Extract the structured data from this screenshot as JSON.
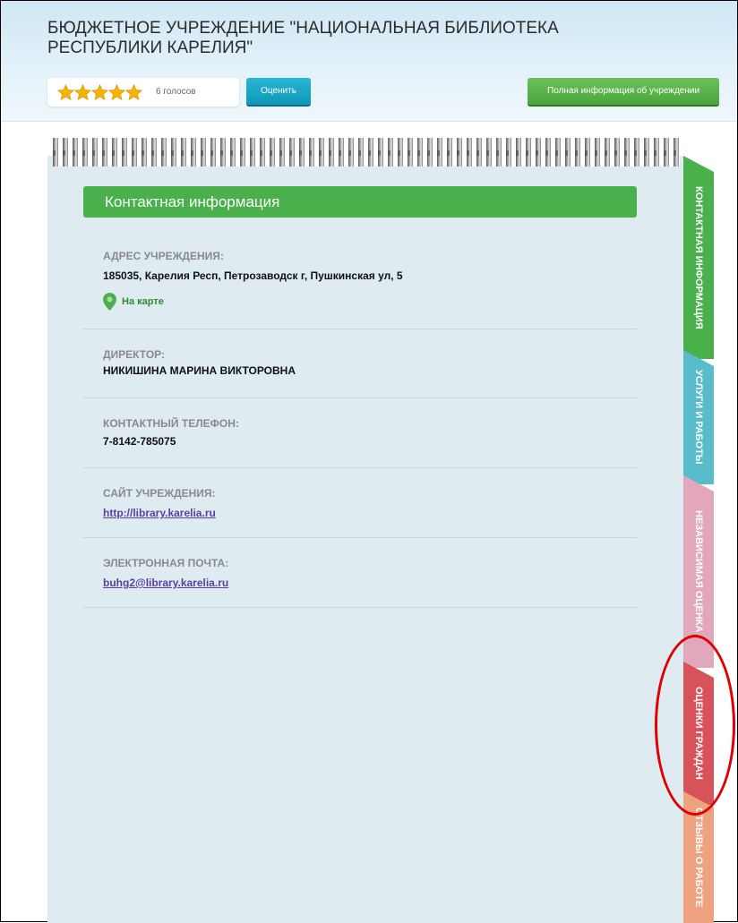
{
  "header": {
    "title": "БЮДЖЕТНОЕ УЧРЕЖДЕНИЕ \"НАЦИОНАЛЬНАЯ БИБЛИОТЕКА РЕСПУБЛИКИ КАРЕЛИЯ\"",
    "rating": {
      "stars_filled": 5,
      "stars_total": 5,
      "votes": "6 голосов"
    },
    "rate_button": "Оценить",
    "full_info_button": "Полная информация об учреждении"
  },
  "section": {
    "title": "Контактная информация",
    "address_label": "АДРЕС УЧРЕЖДЕНИЯ:",
    "address_value": "185035, Карелия Респ, Петрозаводск г, Пушкинская ул, 5",
    "map_link": "На карте",
    "director_label": "ДИРЕКТОР:",
    "director_value": "НИКИШИНА МАРИНА ВИКТОРОВНА",
    "phone_label": "КОНТАКТНЫЙ ТЕЛЕФОН:",
    "phone_value": "7-8142-785075",
    "site_label": "САЙТ УЧРЕЖДЕНИЯ:",
    "site_value": "http://library.karelia.ru",
    "email_label": "ЭЛЕКТРОННАЯ ПОЧТА:",
    "email_value": "buhg2@library.karelia.ru"
  },
  "tabs": [
    {
      "label": "КОНТАКТНАЯ ИНФОРМАЦИЯ",
      "color": "#4ab04c",
      "active": true
    },
    {
      "label": "УСЛУГИ И РАБОТЫ",
      "color": "#58bccb"
    },
    {
      "label": "НЕЗАВИСИМАЯ ОЦЕНКА",
      "color": "#e2a7bb"
    },
    {
      "label": "ОЦЕНКИ ГРАЖДАН",
      "color": "#d8525a"
    },
    {
      "label": "ОТЗЫВЫ О РАБОТЕ",
      "color": "#eea27f"
    }
  ],
  "colors": {
    "highlight": "#e10000",
    "star": "#f5b400"
  }
}
